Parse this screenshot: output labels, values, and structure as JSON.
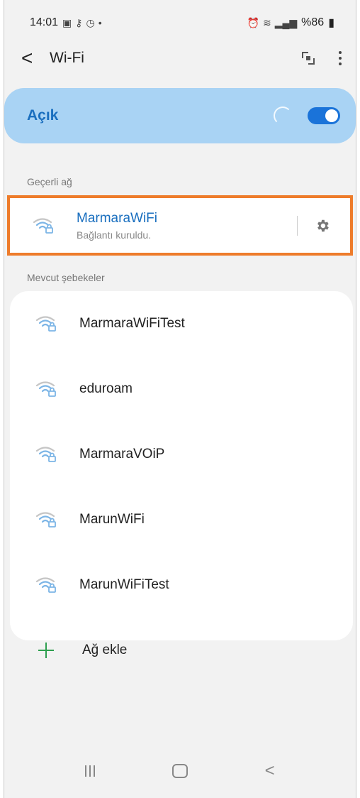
{
  "status_bar": {
    "time": "14:01",
    "battery": "%86"
  },
  "app_bar": {
    "back": "<",
    "title": "Wi-Fi"
  },
  "toggle": {
    "label": "Açık",
    "state": "on"
  },
  "current_section": {
    "header": "Geçerli ağ",
    "network": {
      "name": "MarmaraWiFi",
      "status": "Bağlantı kuruldu."
    }
  },
  "available_section": {
    "header": "Mevcut şebekeler",
    "networks": [
      {
        "name": "MarmaraWiFiTest"
      },
      {
        "name": "eduroam"
      },
      {
        "name": "MarmaraVOiP"
      },
      {
        "name": "MarunWiFi"
      },
      {
        "name": "MarunWiFiTest"
      }
    ],
    "add_label": "Ağ ekle"
  },
  "nav_bar": {
    "back": "<"
  },
  "colors": {
    "accent": "#1a6fbf",
    "highlight_border": "#ee7c2b",
    "add_green": "#2e9f4f",
    "toggle_bg": "#a9d3f4"
  }
}
